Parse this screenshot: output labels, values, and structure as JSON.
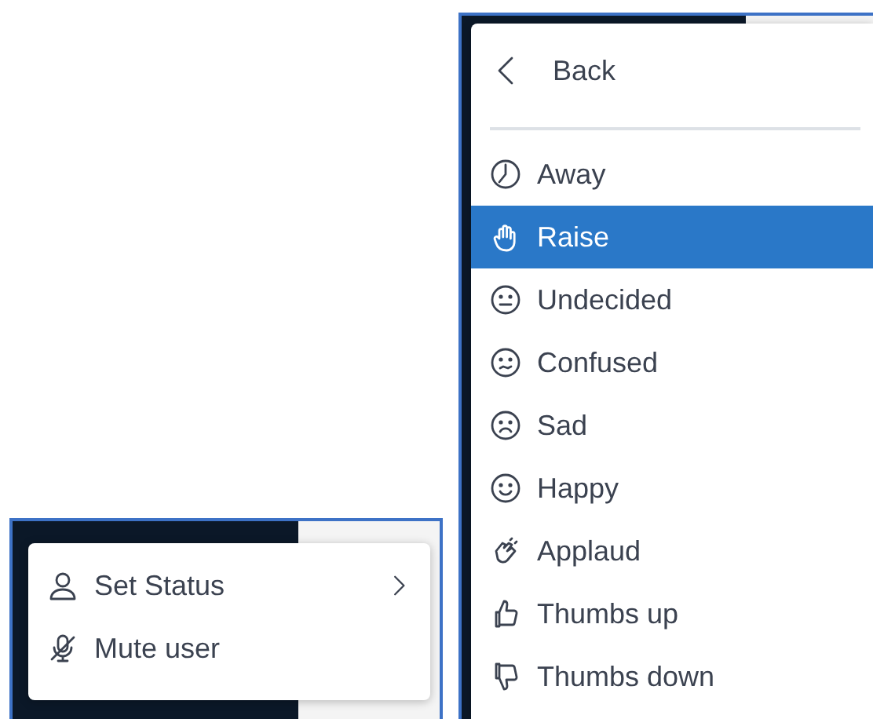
{
  "user_menu": {
    "items": [
      {
        "label": "Set Status",
        "submenu": true
      },
      {
        "label": "Mute user",
        "submenu": false
      }
    ]
  },
  "status_menu": {
    "back": "Back",
    "items": [
      {
        "label": "Away",
        "selected": false
      },
      {
        "label": "Raise",
        "selected": true
      },
      {
        "label": "Undecided",
        "selected": false
      },
      {
        "label": "Confused",
        "selected": false
      },
      {
        "label": "Sad",
        "selected": false
      },
      {
        "label": "Happy",
        "selected": false
      },
      {
        "label": "Applaud",
        "selected": false
      },
      {
        "label": "Thumbs up",
        "selected": false
      },
      {
        "label": "Thumbs down",
        "selected": false
      }
    ]
  }
}
